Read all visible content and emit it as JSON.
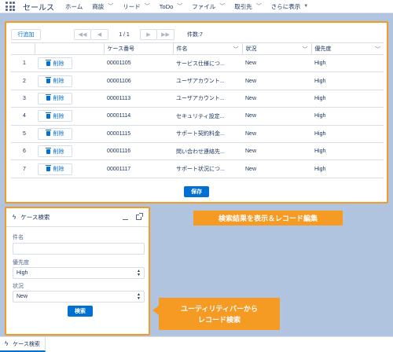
{
  "nav": {
    "app_name": "セールス",
    "items": [
      {
        "label": "ホーム",
        "has_menu": false
      },
      {
        "label": "商談",
        "has_menu": true
      },
      {
        "label": "リード",
        "has_menu": true
      },
      {
        "label": "ToDo",
        "has_menu": true
      },
      {
        "label": "ファイル",
        "has_menu": true
      },
      {
        "label": "取引先",
        "has_menu": true
      }
    ],
    "more_label": "さらに表示"
  },
  "grid": {
    "add_row_label": "行追加",
    "page_info": "1 / 1",
    "count_label": "件数:7",
    "columns": [
      "",
      "",
      "ケース番号",
      "件名",
      "状況",
      "優先度"
    ],
    "delete_label": "削除",
    "rows": [
      {
        "num": "1",
        "case": "00001105",
        "subject": "サービス仕様につ...",
        "status": "New",
        "priority": "High"
      },
      {
        "num": "2",
        "case": "00001106",
        "subject": "ユーザアカウント...",
        "status": "New",
        "priority": "High"
      },
      {
        "num": "3",
        "case": "00001113",
        "subject": "ユーザアカウント...",
        "status": "New",
        "priority": "High"
      },
      {
        "num": "4",
        "case": "00001114",
        "subject": "セキュリティ設定...",
        "status": "New",
        "priority": "High"
      },
      {
        "num": "5",
        "case": "00001115",
        "subject": "サポート契約料金...",
        "status": "New",
        "priority": "High"
      },
      {
        "num": "6",
        "case": "00001116",
        "subject": "問い合わせ連絡先...",
        "status": "New",
        "priority": "High"
      },
      {
        "num": "7",
        "case": "00001117",
        "subject": "サポート状況につ...",
        "status": "New",
        "priority": "High"
      }
    ],
    "save_label": "保存"
  },
  "callouts": {
    "main": "検索結果を表示＆レコード編集",
    "utility_line1": "ユーティリティバーから",
    "utility_line2": "レコード検索"
  },
  "utility_panel": {
    "title": "ケース検索",
    "subject_label": "件名",
    "subject_value": "",
    "priority_label": "優先度",
    "priority_value": "High",
    "status_label": "状況",
    "status_value": "New",
    "search_label": "検索"
  },
  "utility_bar": {
    "item_label": "ケース検索"
  },
  "colors": {
    "accent": "#f59a23",
    "brand": "#0070d2",
    "background": "#b0c4df"
  }
}
